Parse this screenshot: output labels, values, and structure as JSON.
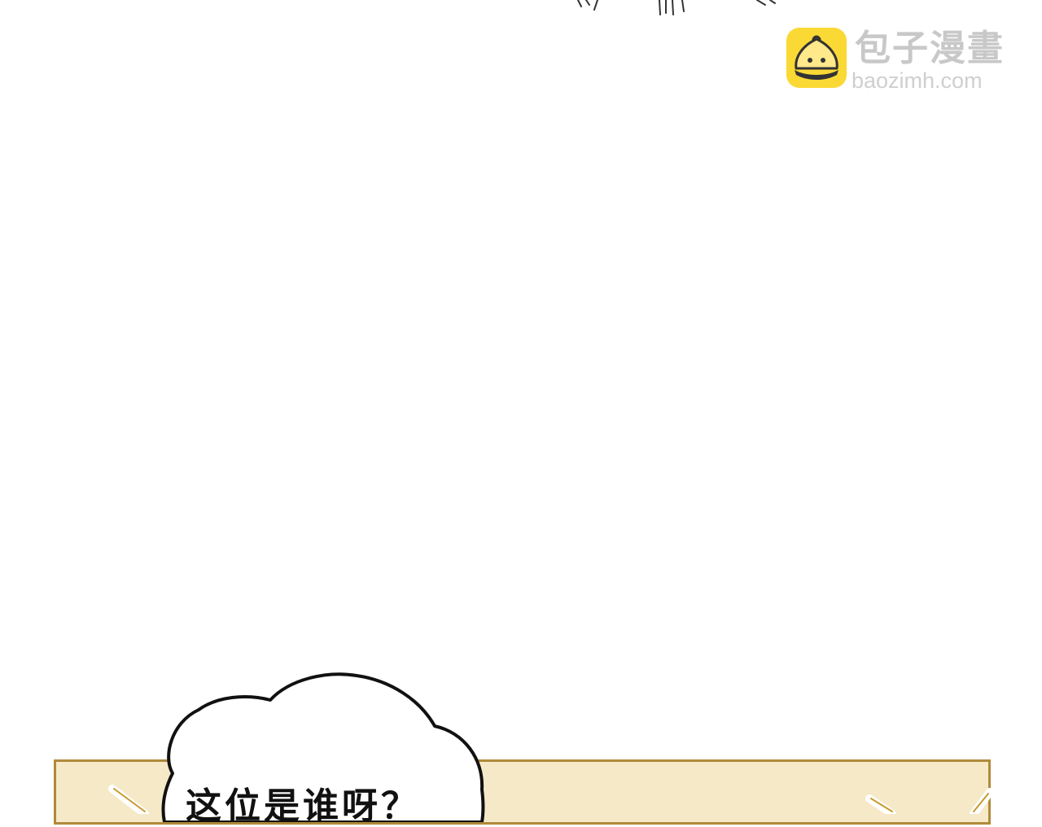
{
  "watermark": {
    "name_cn": "包子漫畫",
    "url": "baozimh.com",
    "logo_color": "#fbd935",
    "text_color": "#c8c8c8"
  },
  "speech": {
    "text": "这位是谁呀？"
  },
  "panel": {
    "fill_color": "#f5e9c8",
    "border_color": "#b08a3a"
  },
  "icons": {
    "logo": "bun-mascot-icon"
  }
}
